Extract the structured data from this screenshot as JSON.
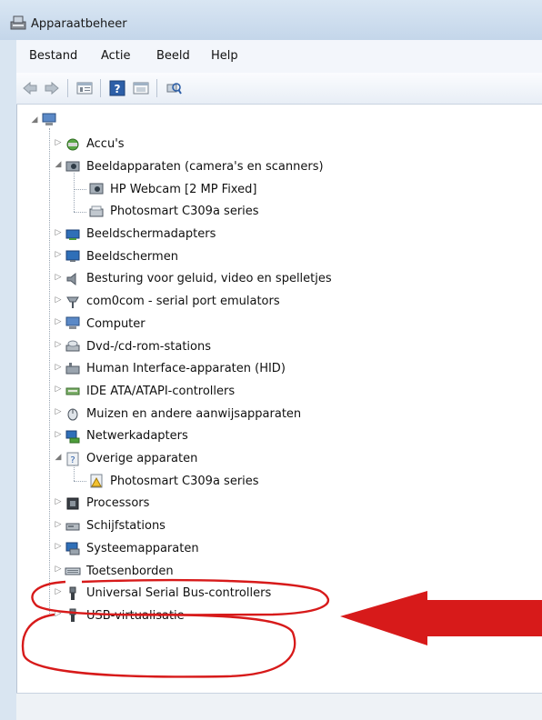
{
  "window": {
    "title": "Apparaatbeheer"
  },
  "menu": [
    "Bestand",
    "Actie",
    "Beeld",
    "Help"
  ],
  "toolbar_icons": [
    "back-arrow-icon",
    "forward-arrow-icon",
    "properties-icon",
    "help-icon",
    "update-driver-icon",
    "scan-hardware-icon"
  ],
  "tree": {
    "root_icon": "computer-icon",
    "items": [
      {
        "label": "Accu's",
        "icon": "battery-icon",
        "expanded": false
      },
      {
        "label": "Beeldapparaten (camera's en scanners)",
        "icon": "camera-icon",
        "expanded": true,
        "children": [
          {
            "label": "HP Webcam [2 MP Fixed]",
            "icon": "webcam-icon"
          },
          {
            "label": "Photosmart C309a series",
            "icon": "scanner-icon"
          }
        ]
      },
      {
        "label": "Beeldschermadapters",
        "icon": "display-adapter-icon",
        "expanded": false
      },
      {
        "label": "Beeldschermen",
        "icon": "monitor-icon",
        "expanded": false
      },
      {
        "label": "Besturing voor geluid, video en spelletjes",
        "icon": "speaker-icon",
        "expanded": false
      },
      {
        "label": "com0com - serial port emulators",
        "icon": "port-icon",
        "expanded": false
      },
      {
        "label": "Computer",
        "icon": "computer-icon",
        "expanded": false
      },
      {
        "label": "Dvd-/cd-rom-stations",
        "icon": "dvd-drive-icon",
        "expanded": false
      },
      {
        "label": "Human Interface-apparaten (HID)",
        "icon": "hid-icon",
        "expanded": false
      },
      {
        "label": "IDE ATA/ATAPI-controllers",
        "icon": "ide-controller-icon",
        "expanded": false
      },
      {
        "label": "Muizen en andere aanwijsapparaten",
        "icon": "mouse-icon",
        "expanded": false
      },
      {
        "label": "Netwerkadapters",
        "icon": "network-adapter-icon",
        "expanded": false
      },
      {
        "label": "Overige apparaten",
        "icon": "unknown-device-icon",
        "expanded": true,
        "children": [
          {
            "label": "Photosmart C309a series",
            "icon": "warning-device-icon"
          }
        ]
      },
      {
        "label": "Processors",
        "icon": "processor-icon",
        "expanded": false
      },
      {
        "label": "Schijfstations",
        "icon": "disk-drive-icon",
        "expanded": false
      },
      {
        "label": "Systeemapparaten",
        "icon": "system-device-icon",
        "expanded": false
      },
      {
        "label": "Toetsenborden",
        "icon": "keyboard-icon",
        "expanded": false
      },
      {
        "label": "Universal Serial Bus-controllers",
        "icon": "usb-icon",
        "expanded": false
      },
      {
        "label": "USB-virtualisatie",
        "icon": "usb-icon",
        "expanded": false
      }
    ]
  },
  "colors": {
    "annotation": "#d71a1a",
    "selection_frame": "#b9c4d3"
  }
}
